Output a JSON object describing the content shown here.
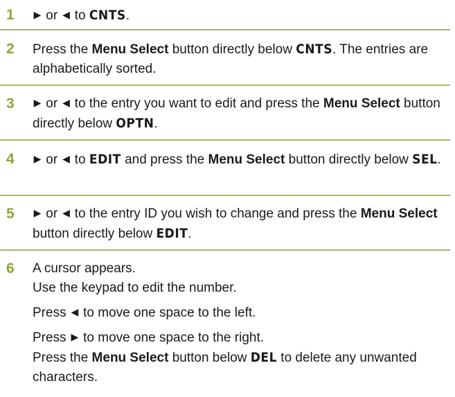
{
  "colors": {
    "step_number": "#8aa63a",
    "rule": "#a3b86c",
    "text": "#1a1a1a"
  },
  "icons": {
    "right": "right-arrow-icon",
    "left": "left-arrow-icon"
  },
  "glyph": {
    "right": "▶",
    "left": "◀"
  },
  "words": {
    "or": "or",
    "to": "to",
    "press": "Press",
    "menu_select": "Menu Select"
  },
  "steps": [
    {
      "number": "1",
      "text": {
        "a": "to",
        "kw": "CNTS",
        "end": "."
      }
    },
    {
      "number": "2",
      "text": {
        "a": "Press the",
        "kw": "CNTS",
        "b": "button directly below",
        "end": ". The entries are alphabetically sorted."
      }
    },
    {
      "number": "3",
      "text": {
        "a": "to the entry you want to edit and press the",
        "b2": "Select",
        "c": "button directly below",
        "kw": "OPTN",
        "end": "."
      }
    },
    {
      "number": "4",
      "text": {
        "a": "to",
        "kw": "EDIT",
        "b": "and press the",
        "c": "button directly below",
        "kw2": "SEL",
        "end": "."
      }
    },
    {
      "number": "5",
      "text": {
        "a": "to the entry ID you wish to change and press the",
        "c": "button directly below",
        "kw": "EDIT",
        "end": "."
      }
    },
    {
      "number": "6",
      "text": {
        "l1": "A cursor appears.",
        "l2": "Use the keypad to edit the number.",
        "l3": "to move one space to the left.",
        "l4": "to move one space to the right.",
        "l5a": "Press the",
        "l5b": "button below",
        "kw": "DEL",
        "l5c": "to delete any unwanted characters."
      }
    }
  ]
}
